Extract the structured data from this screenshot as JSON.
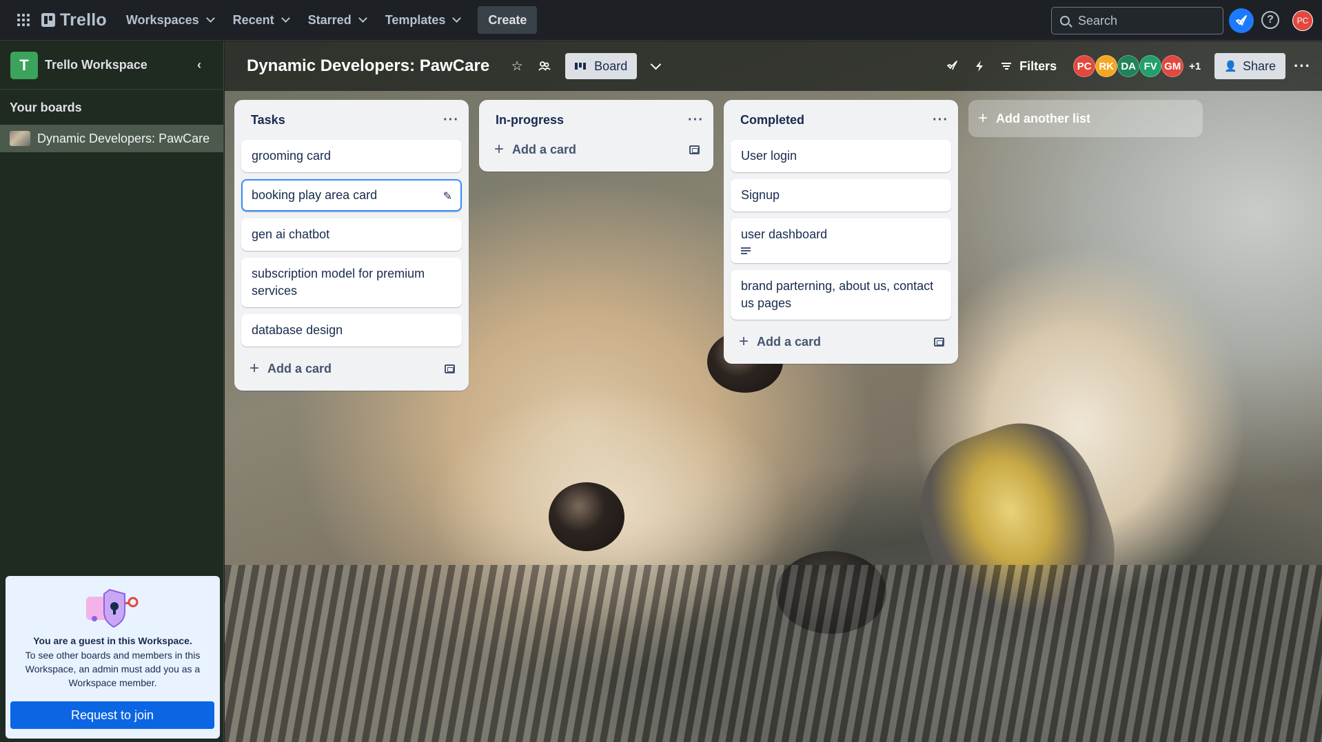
{
  "topnav": {
    "logo": "Trello",
    "menus": [
      "Workspaces",
      "Recent",
      "Starred",
      "Templates"
    ],
    "create_label": "Create",
    "search_placeholder": "Search",
    "user_initials": "PC"
  },
  "sidebar": {
    "workspace_badge": "T",
    "workspace_name": "Trello Workspace",
    "section_title": "Your boards",
    "boards": [
      {
        "name": "Dynamic Developers: PawCare"
      }
    ],
    "guest": {
      "title": "You are a guest in this Workspace.",
      "text": "To see other boards and members in this Workspace, an admin must add you as a Workspace member.",
      "button": "Request to join"
    }
  },
  "board": {
    "title": "Dynamic Developers: PawCare",
    "view_label": "Board",
    "filters_label": "Filters",
    "members": [
      {
        "initials": "PC",
        "color": "#e2483d"
      },
      {
        "initials": "RK",
        "color": "#f5a623"
      },
      {
        "initials": "DA",
        "color": "#1f845a"
      },
      {
        "initials": "FV",
        "color": "#22a06b"
      },
      {
        "initials": "GM",
        "color": "#e2483d"
      }
    ],
    "extra_members": "+1",
    "share_label": "Share"
  },
  "lists": [
    {
      "title": "Tasks",
      "cards": [
        "grooming card",
        "booking play area card",
        "gen ai chatbot",
        "subscription model for premium services",
        "database design"
      ],
      "add_card": "Add a card"
    },
    {
      "title": "In-progress",
      "cards": [],
      "add_card": "Add a card"
    },
    {
      "title": "Completed",
      "cards": [
        "User login",
        "Signup",
        "user dashboard",
        "brand parterning, about us, contact us pages"
      ],
      "add_card": "Add a card"
    }
  ],
  "add_list_label": "Add another list"
}
